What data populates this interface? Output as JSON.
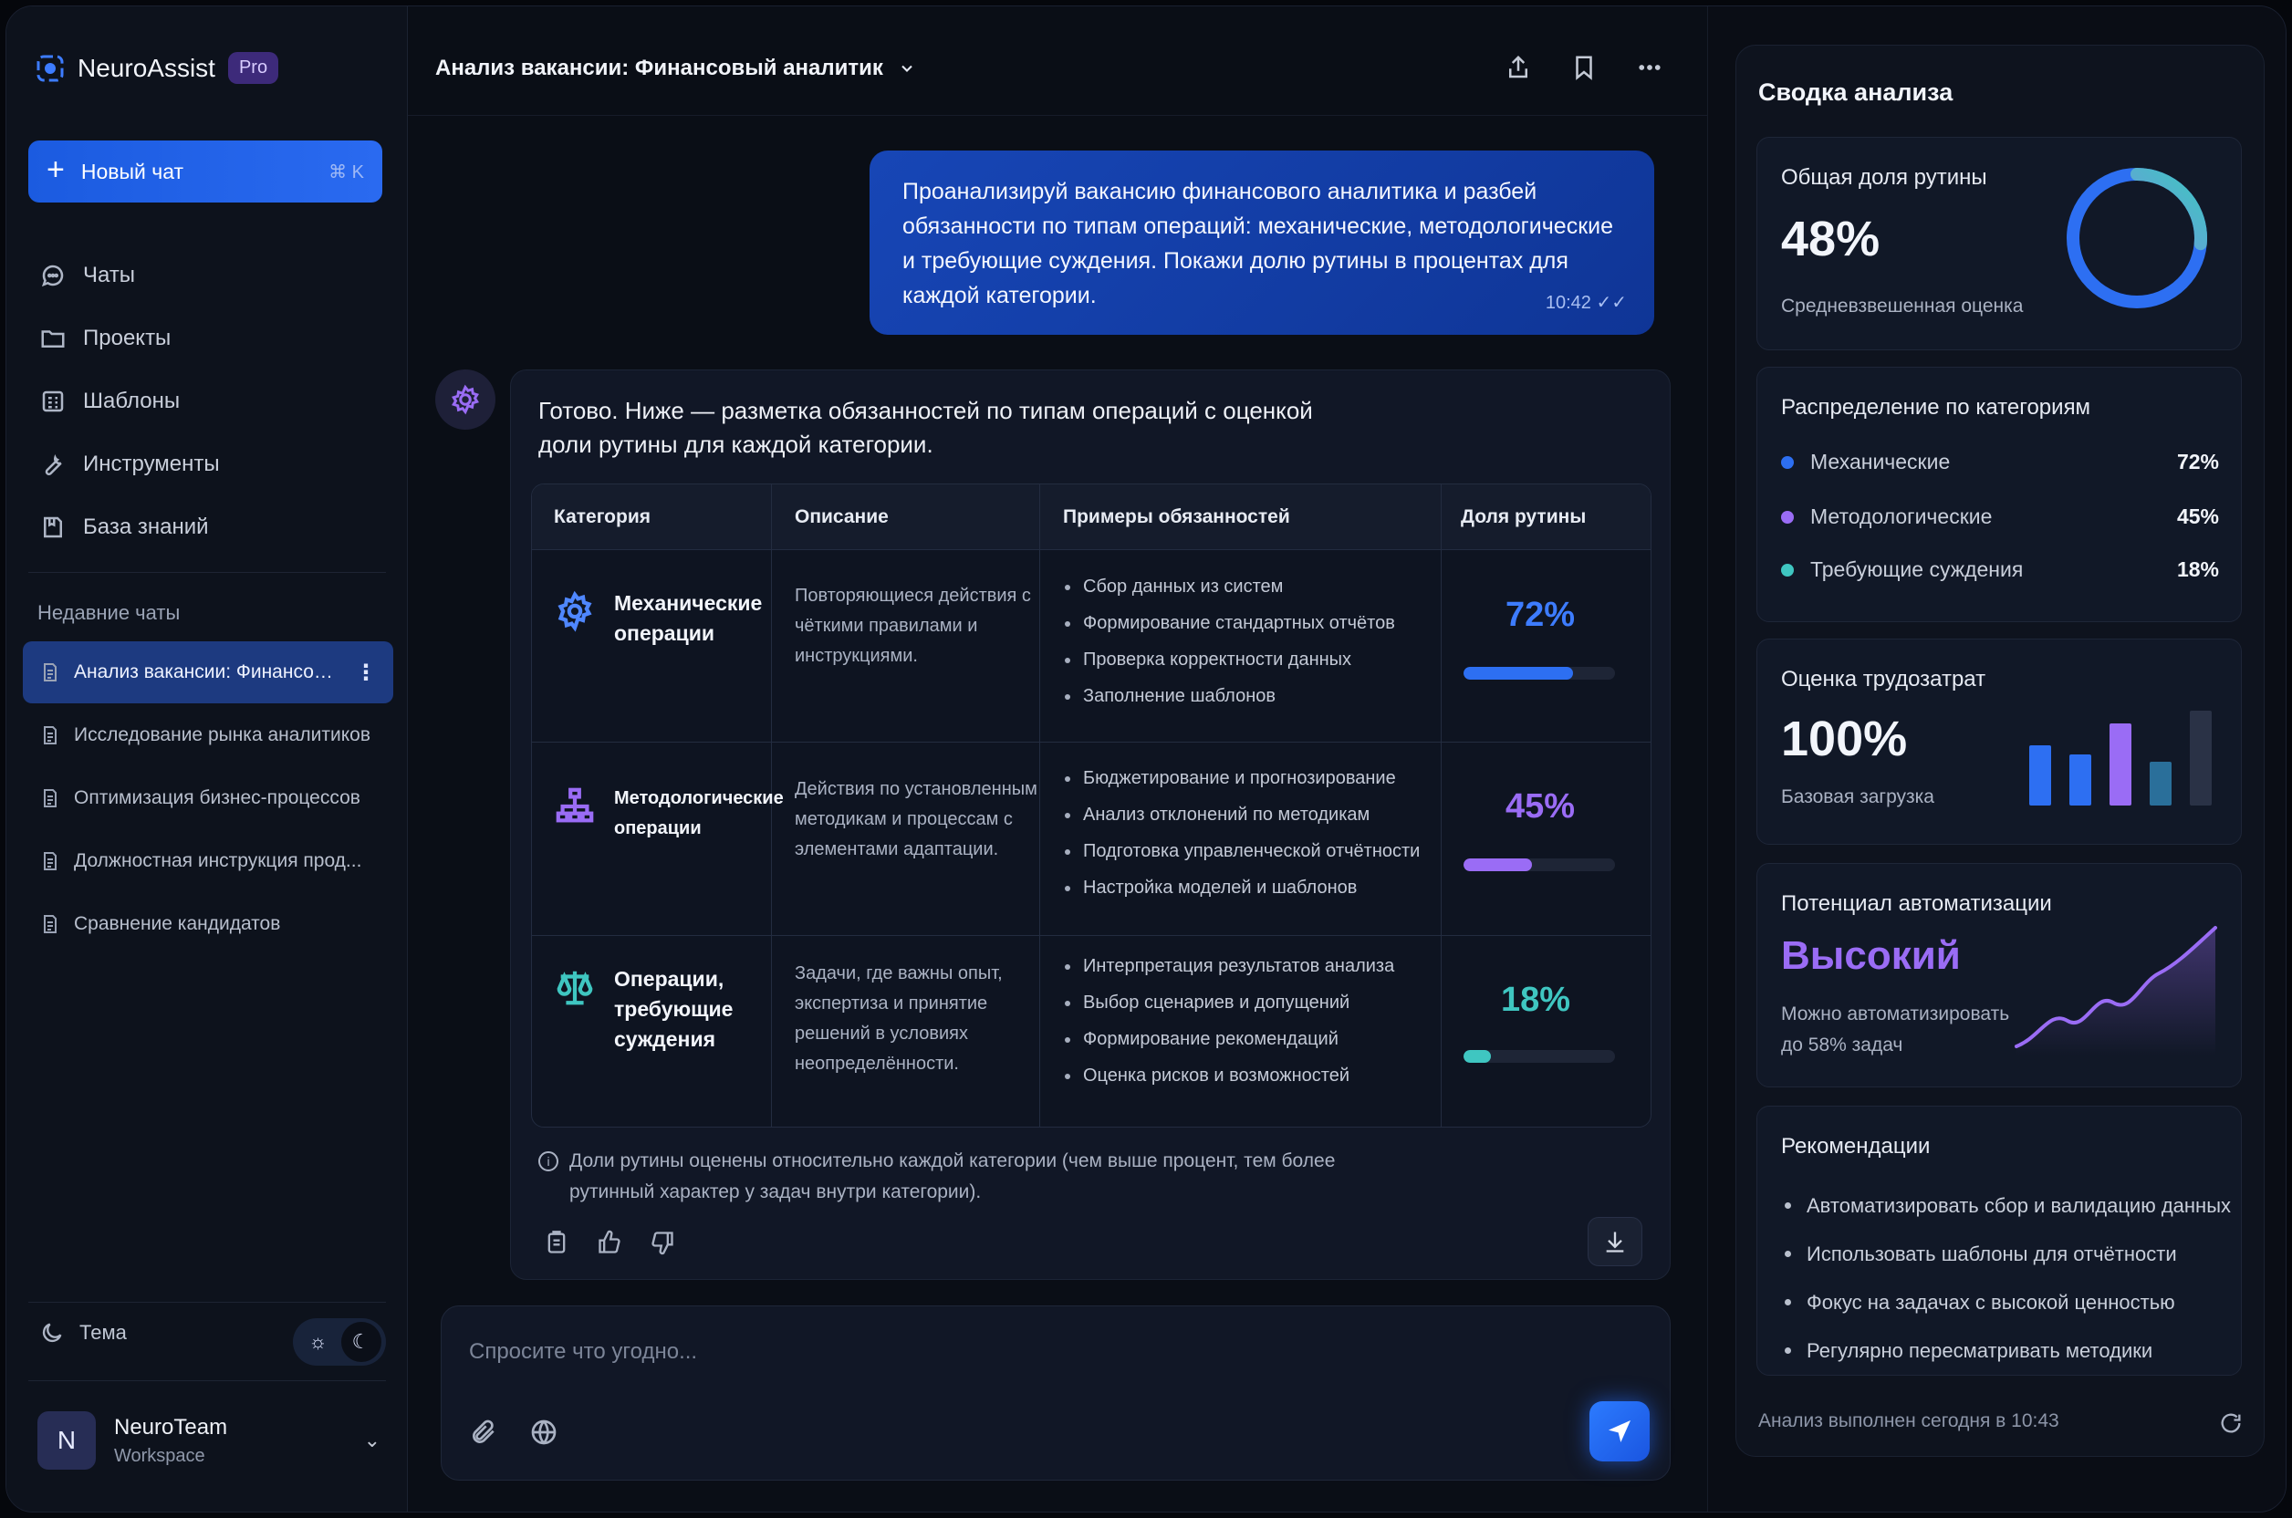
{
  "brand": {
    "name": "NeuroAssist",
    "badge": "Pro"
  },
  "sidebar": {
    "new_chat": {
      "label": "Новый чат",
      "shortcut": "⌘ K"
    },
    "nav": [
      {
        "label": "Чаты",
        "icon": "chat-icon"
      },
      {
        "label": "Проекты",
        "icon": "folder-icon"
      },
      {
        "label": "Шаблоны",
        "icon": "template-icon"
      },
      {
        "label": "Инструменты",
        "icon": "wrench-icon"
      },
      {
        "label": "База знаний",
        "icon": "book-icon"
      }
    ],
    "recent_title": "Недавние чаты",
    "recent": [
      {
        "label": "Анализ вакансии: Финансовый ...",
        "active": true
      },
      {
        "label": "Исследование рынка аналитиков"
      },
      {
        "label": "Оптимизация бизнес-процессов"
      },
      {
        "label": "Должностная инструкция прод..."
      },
      {
        "label": "Сравнение кандидатов"
      }
    ],
    "theme_label": "Тема",
    "workspace": {
      "initial": "N",
      "name": "NeuroTeam",
      "sub": "Workspace"
    }
  },
  "main": {
    "title": "Анализ вакансии: Финансовый аналитик",
    "user_message": "Проанализируй вакансию финансового аналитика и разбей обязанности по типам операций: механические, методологические и требующие суждения. Покажи долю рутины в процентах для каждой категории.",
    "user_time": "10:42",
    "bot_intro": "Готово. Ниже — разметка обязанностей по типам операций с оценкой доли рутины для каждой категории.",
    "table": {
      "headers": [
        "Категория",
        "Описание",
        "Примеры обязанностей",
        "Доля рутины"
      ],
      "rows": [
        {
          "category": "Механические операции",
          "description": "Повторяющиеся действия с чёткими правилами и инструкциями.",
          "examples": [
            "Сбор данных из систем",
            "Формирование стандартных отчётов",
            "Проверка корректности данных",
            "Заполнение шаблонов"
          ],
          "percent_label": "72%",
          "value": 0.72,
          "color": "#2d6ff2"
        },
        {
          "category": "Методологические операции",
          "description": "Действия по установленным методикам и процессам с элементами адаптации.",
          "examples": [
            "Бюджетирование и прогнозирование",
            "Анализ отклонений по методикам",
            "Подготовка управленческой отчётности",
            "Настройка моделей и шаблонов"
          ],
          "percent_label": "45%",
          "value": 0.45,
          "color": "#9a6cf5"
        },
        {
          "category": "Операции, требующие суждения",
          "description": "Задачи, где важны опыт, экспертиза и принятие решений в условиях неопределённости.",
          "examples": [
            "Интерпретация результатов анализа",
            "Выбор сценариев и допущений",
            "Формирование рекомендаций",
            "Оценка рисков и возможностей"
          ],
          "percent_label": "18%",
          "value": 0.18,
          "color": "#3fc6c1"
        }
      ]
    },
    "note": "Доли рутины оценены относительно каждой категории (чем выше процент, тем более рутинный характер у задач внутри категории).",
    "composer_placeholder": "Спросите что угодно..."
  },
  "summary": {
    "title": "Сводка анализа",
    "routine": {
      "title": "Общая доля рутины",
      "value": "48%",
      "sub": "Средневзвешенная оценка",
      "fraction": 0.48
    },
    "distribution": {
      "title": "Распределение по категориям",
      "items": [
        {
          "label": "Механические",
          "value": "72%",
          "color": "#2d6ff2"
        },
        {
          "label": "Методологические",
          "value": "45%",
          "color": "#9a6cf5"
        },
        {
          "label": "Требующие суждения",
          "value": "18%",
          "color": "#3fc6c1"
        }
      ]
    },
    "effort": {
      "title": "Оценка трудозатрат",
      "value": "100%",
      "sub": "Базовая загрузка"
    },
    "automation": {
      "title": "Потенциал автоматизации",
      "value": "Высокий",
      "sub": "Можно автоматизировать до 58% задач"
    },
    "recommendations": {
      "title": "Рекомендации",
      "items": [
        "Автоматизировать сбор и валидацию данных",
        "Использовать шаблоны для отчётности",
        "Фокус на задачах с высокой ценностью",
        "Регулярно пересматривать методики"
      ]
    },
    "footer": "Анализ выполнен сегодня в 10:43"
  }
}
